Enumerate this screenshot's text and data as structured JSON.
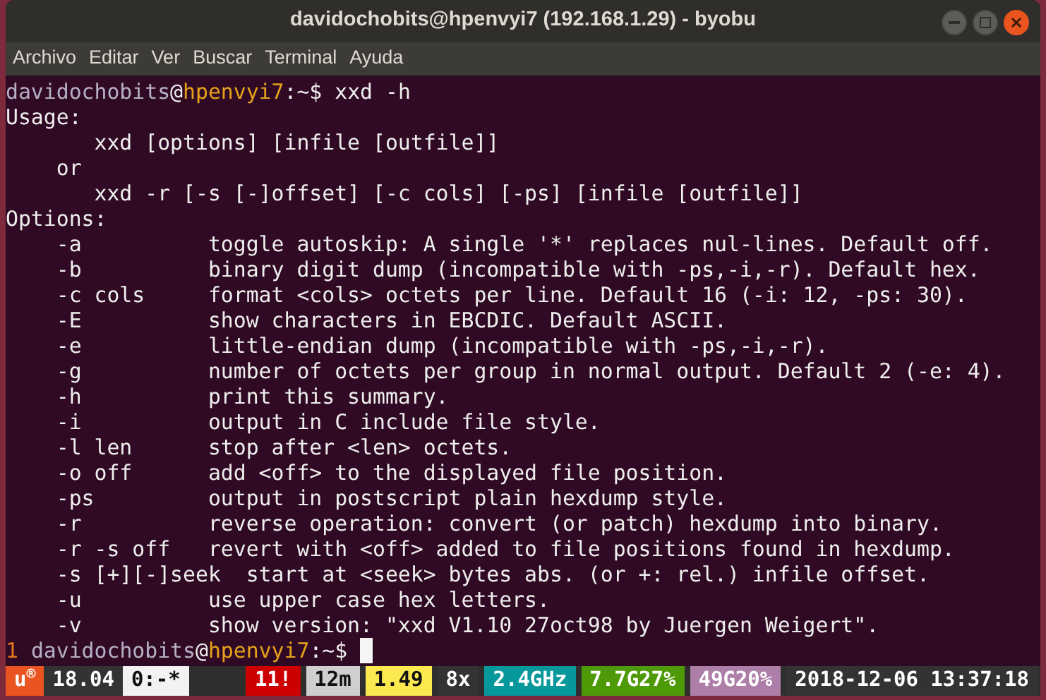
{
  "window": {
    "title": "davidochobits@hpenvyi7 (192.168.1.29) - byobu"
  },
  "menu": [
    "Archivo",
    "Editar",
    "Ver",
    "Buscar",
    "Terminal",
    "Ayuda"
  ],
  "terminal": {
    "lines": [
      {
        "kind": "prompt",
        "user": "davidochobits",
        "at": "@",
        "host": "hpenvyi7",
        "path": ":~$",
        "command": " xxd -h"
      },
      {
        "kind": "text",
        "text": "Usage:"
      },
      {
        "kind": "text",
        "text": "       xxd [options] [infile [outfile]]"
      },
      {
        "kind": "text",
        "text": "    or"
      },
      {
        "kind": "text",
        "text": "       xxd -r [-s [-]offset] [-c cols] [-ps] [infile [outfile]]"
      },
      {
        "kind": "text",
        "text": "Options:"
      },
      {
        "kind": "text",
        "text": "    -a          toggle autoskip: A single '*' replaces nul-lines. Default off."
      },
      {
        "kind": "text",
        "text": "    -b          binary digit dump (incompatible with -ps,-i,-r). Default hex."
      },
      {
        "kind": "text",
        "text": "    -c cols     format <cols> octets per line. Default 16 (-i: 12, -ps: 30)."
      },
      {
        "kind": "text",
        "text": "    -E          show characters in EBCDIC. Default ASCII."
      },
      {
        "kind": "text",
        "text": "    -e          little-endian dump (incompatible with -ps,-i,-r)."
      },
      {
        "kind": "text",
        "text": "    -g          number of octets per group in normal output. Default 2 (-e: 4)."
      },
      {
        "kind": "text",
        "text": "    -h          print this summary."
      },
      {
        "kind": "text",
        "text": "    -i          output in C include file style."
      },
      {
        "kind": "text",
        "text": "    -l len      stop after <len> octets."
      },
      {
        "kind": "text",
        "text": "    -o off      add <off> to the displayed file position."
      },
      {
        "kind": "text",
        "text": "    -ps         output in postscript plain hexdump style."
      },
      {
        "kind": "text",
        "text": "    -r          reverse operation: convert (or patch) hexdump into binary."
      },
      {
        "kind": "text",
        "text": "    -r -s off   revert with <off> added to file positions found in hexdump."
      },
      {
        "kind": "text",
        "text": "    -s [+][-]seek  start at <seek> bytes abs. (or +: rel.) infile offset."
      },
      {
        "kind": "text",
        "text": "    -u          use upper case hex letters."
      },
      {
        "kind": "text",
        "text": "    -v          show version: \"xxd V1.10 27oct98 by Juergen Weigert\"."
      },
      {
        "kind": "prompt",
        "window": "1 ",
        "user": "davidochobits",
        "at": "@",
        "host": "hpenvyi7",
        "path": ":~$",
        "cursor": true
      }
    ]
  },
  "status_bar": {
    "left": [
      {
        "text": "u$^{®}$",
        "color": "#e95420"
      },
      {
        "text": "18.04",
        "color": "#333333"
      },
      {
        "text": "0:-*",
        "color": "#f2f2f2"
      }
    ],
    "right": [
      {
        "text": "11!",
        "color": "#cc0000"
      },
      {
        "text": "12m",
        "color": "#cfcfcf"
      },
      {
        "text": "1.49",
        "color": "#fce94f"
      },
      {
        "text": "8x",
        "color": "#333333"
      },
      {
        "text": "2.4GHz",
        "color": "#06989a"
      },
      {
        "text": "7.7G27%",
        "color": "#4e9a06"
      },
      {
        "text": "49G20%",
        "color": "#ad7fa8"
      },
      {
        "text": "2018-12-06 13:37:18",
        "color": "#333333"
      }
    ]
  }
}
